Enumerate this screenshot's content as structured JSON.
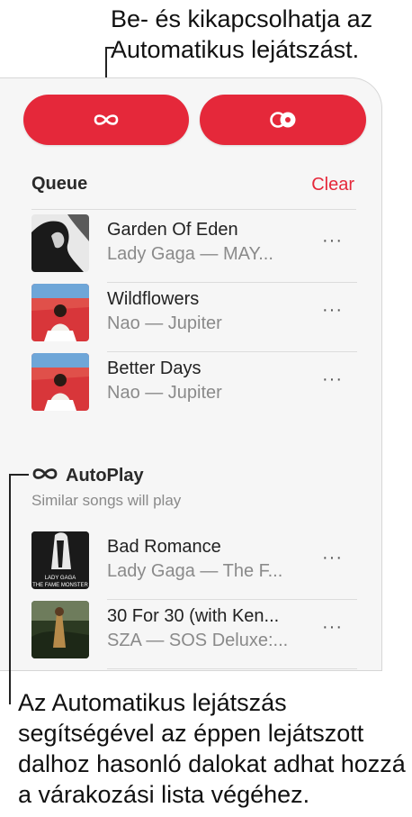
{
  "callouts": {
    "top": "Be- és kikapcsolhatja az Automatikus lejátszást.",
    "bottom": "Az Automatikus lejátszás segítségével az éppen lejátszott dalhoz hasonló dalokat adhat hozzá a várakozási lista végéhez."
  },
  "controls": {
    "autoplay_icon": "infinity-icon",
    "repeat_icon": "repeat-icon",
    "accent_color": "#e5283a"
  },
  "queue": {
    "title": "Queue",
    "clear_label": "Clear",
    "tracks": [
      {
        "title": "Garden Of Eden",
        "subtitle": "Lady Gaga — MAY...",
        "more": "···"
      },
      {
        "title": "Wildflowers",
        "subtitle": "Nao — Jupiter",
        "more": "···"
      },
      {
        "title": "Better Days",
        "subtitle": "Nao — Jupiter",
        "more": "···"
      }
    ]
  },
  "autoplay": {
    "title": "AutoPlay",
    "subtitle": "Similar songs will play",
    "tracks": [
      {
        "title": "Bad Romance",
        "subtitle": "Lady Gaga — The F...",
        "more": "···",
        "art_text_1": "LADY GAGA",
        "art_text_2": "THE FAME MONSTER"
      },
      {
        "title": "30 For 30 (with Ken...",
        "subtitle": "SZA — SOS Deluxe:...",
        "more": "···"
      }
    ]
  }
}
